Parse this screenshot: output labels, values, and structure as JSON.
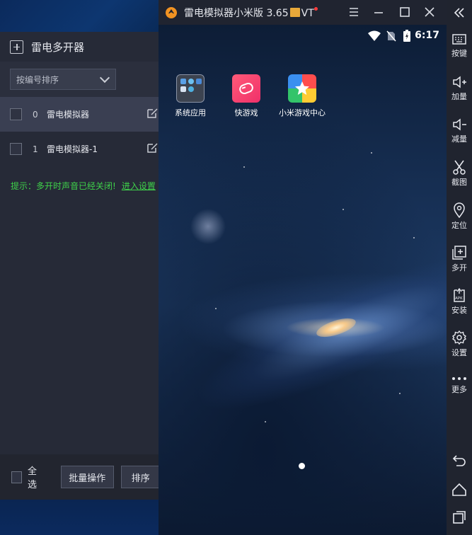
{
  "multi_opener": {
    "title": "雷电多开器",
    "sort_select": "按编号排序",
    "instances": [
      {
        "index": "0",
        "name": "雷电模拟器",
        "selected": true
      },
      {
        "index": "1",
        "name": "雷电模拟器-1",
        "selected": false
      }
    ],
    "hint": "提示：多开时声音已经关闭!",
    "hint_link": "进入设置",
    "footer": {
      "select_all": "全选",
      "batch_button": "批量操作",
      "sort_button": "排序"
    }
  },
  "emulator": {
    "title": "雷电模拟器小米版 3.65",
    "title_suffix": "VT",
    "status_time": "6:17",
    "apps": [
      {
        "label": "系统应用",
        "icon": "system-apps-folder-icon"
      },
      {
        "label": "快游戏",
        "icon": "quick-game-icon"
      },
      {
        "label": "小米游戏中心",
        "icon": "mi-game-center-icon"
      }
    ]
  },
  "toolbar": {
    "items": [
      {
        "label": "按键",
        "icon": "keyboard-icon"
      },
      {
        "label": "加量",
        "icon": "volume-up-icon"
      },
      {
        "label": "减量",
        "icon": "volume-down-icon"
      },
      {
        "label": "截图",
        "icon": "scissors-icon"
      },
      {
        "label": "定位",
        "icon": "location-pin-icon"
      },
      {
        "label": "多开",
        "icon": "multi-open-icon"
      },
      {
        "label": "安装",
        "icon": "apk-install-icon"
      },
      {
        "label": "设置",
        "icon": "gear-icon"
      },
      {
        "label": "更多",
        "icon": "more-dots-icon"
      }
    ]
  },
  "colors": {
    "panel_bg": "#262a37",
    "hint_green": "#3fd14a",
    "titlebar_bg": "#202430",
    "logo_orange": "#f29322"
  }
}
